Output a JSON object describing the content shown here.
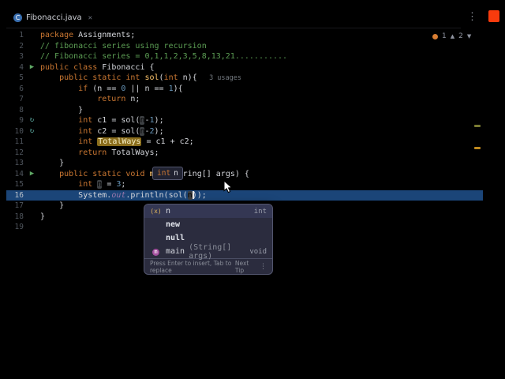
{
  "tab_bar": {
    "tab": {
      "label": "Fibonacci.java"
    }
  },
  "icons": {
    "java_class_glyph": "C",
    "close_glyph": "✕",
    "kebab_glyph": "⋮",
    "run_glyph": "▶",
    "recursion_glyph": "↻",
    "nav_up_glyph": "▲",
    "nav_down_glyph": "▼"
  },
  "inspection_widget": {
    "errors": "1",
    "warnings": "2"
  },
  "colors": {
    "accent_blue_caret_line": "#1b4578",
    "warning_highlight": "#8a6d1c",
    "recording_indicator": "#f83b0d",
    "keyword": "#cc7832",
    "comment": "#5c9e54"
  },
  "param_tooltip": {
    "type": "int",
    "name": "n"
  },
  "popup": {
    "items": [
      {
        "kind": "param",
        "icon_glyph": "(x)",
        "label": "n",
        "detail": "",
        "type": "int",
        "selected": true
      },
      {
        "kind": "keyword",
        "icon_glyph": "",
        "label": "new",
        "detail": "",
        "type": "",
        "selected": false
      },
      {
        "kind": "keyword",
        "icon_glyph": "",
        "label": "null",
        "detail": "",
        "type": "",
        "selected": false
      },
      {
        "kind": "method",
        "icon_glyph": "m",
        "label": "main",
        "detail": "(String[] args)",
        "type": "void",
        "selected": false
      }
    ],
    "footer_hint": "Press Enter to insert, Tab to replace",
    "footer_tip": "Next Tip",
    "footer_more": "⋮"
  },
  "editor": {
    "caret_line": 16,
    "lines": [
      {
        "n": "1",
        "g": "",
        "t": [
          [
            "package ",
            "kw"
          ],
          [
            "Assignments;",
            "pl"
          ]
        ]
      },
      {
        "n": "2",
        "g": "",
        "t": [
          [
            "// fibonacci series using recursion",
            "cm"
          ]
        ]
      },
      {
        "n": "3",
        "g": "",
        "t": [
          [
            "// Fibonacci series = 0,1,1,2,3,5,8,13,21...........",
            "cm"
          ]
        ]
      },
      {
        "n": "4",
        "g": "run",
        "t": [
          [
            "public class ",
            "kw"
          ],
          [
            "Fibonacci {",
            "pl"
          ]
        ]
      },
      {
        "n": "5",
        "g": "",
        "t": [
          [
            "    ",
            "pl"
          ],
          [
            "public static int ",
            "kw"
          ],
          [
            "sol",
            "fn"
          ],
          [
            "(",
            "pl"
          ],
          [
            "int ",
            "kw"
          ],
          [
            "n){",
            "pl"
          ],
          [
            "   3 usages",
            "us"
          ]
        ]
      },
      {
        "n": "6",
        "g": "",
        "t": [
          [
            "        ",
            "pl"
          ],
          [
            "if ",
            "kw"
          ],
          [
            "(n == ",
            "pl"
          ],
          [
            "0",
            "nm"
          ],
          [
            " || n == ",
            "pl"
          ],
          [
            "1",
            "nm"
          ],
          [
            "){",
            "pl"
          ]
        ]
      },
      {
        "n": "7",
        "g": "",
        "t": [
          [
            "            ",
            "pl"
          ],
          [
            "return ",
            "kw"
          ],
          [
            "n;",
            "pl"
          ]
        ]
      },
      {
        "n": "8",
        "g": "",
        "t": [
          [
            "        }",
            "pl"
          ]
        ]
      },
      {
        "n": "9",
        "g": "rec",
        "t": [
          [
            "        ",
            "pl"
          ],
          [
            "int ",
            "kw"
          ],
          [
            "c1 = sol(",
            "pl"
          ],
          [
            "n",
            "oc"
          ],
          [
            "-",
            "pl"
          ],
          [
            "1",
            "nm"
          ],
          [
            ");",
            "pl"
          ]
        ]
      },
      {
        "n": "10",
        "g": "rec",
        "t": [
          [
            "        ",
            "pl"
          ],
          [
            "int ",
            "kw"
          ],
          [
            "c2 = sol(",
            "pl"
          ],
          [
            "n",
            "oc"
          ],
          [
            "-",
            "pl"
          ],
          [
            "2",
            "nm"
          ],
          [
            ");",
            "pl"
          ]
        ]
      },
      {
        "n": "11",
        "g": "",
        "t": [
          [
            "        ",
            "pl"
          ],
          [
            "int ",
            "kw"
          ],
          [
            "TotalWays",
            "wr"
          ],
          [
            " = c1 + c2;",
            "pl"
          ]
        ]
      },
      {
        "n": "12",
        "g": "",
        "t": [
          [
            "        ",
            "pl"
          ],
          [
            "return ",
            "kw"
          ],
          [
            "TotalWays;",
            "pl"
          ]
        ]
      },
      {
        "n": "13",
        "g": "",
        "t": [
          [
            "    }",
            "pl"
          ]
        ]
      },
      {
        "n": "14",
        "g": "run",
        "t": [
          [
            "    ",
            "pl"
          ],
          [
            "public static void ",
            "kw"
          ],
          [
            "main",
            "fn"
          ],
          [
            "(String[] args) {",
            "pl"
          ]
        ]
      },
      {
        "n": "15",
        "g": "",
        "t": [
          [
            "        ",
            "pl"
          ],
          [
            "int ",
            "kw"
          ],
          [
            "n",
            "oc"
          ],
          [
            " = ",
            "pl"
          ],
          [
            "3",
            "nm"
          ],
          [
            ";",
            "pl"
          ]
        ]
      },
      {
        "n": "16",
        "g": "",
        "t": [
          [
            "        ",
            "pl"
          ],
          [
            "System.",
            "pl"
          ],
          [
            "out",
            "fd"
          ],
          [
            ".println(sol(",
            "pl"
          ],
          [
            "n",
            "oc"
          ],
          [
            "));",
            "pl"
          ]
        ]
      },
      {
        "n": "17",
        "g": "",
        "t": [
          [
            "    }",
            "pl"
          ]
        ]
      },
      {
        "n": "18",
        "g": "",
        "t": [
          [
            "}",
            "pl"
          ]
        ]
      },
      {
        "n": "19",
        "g": "",
        "t": []
      }
    ]
  }
}
